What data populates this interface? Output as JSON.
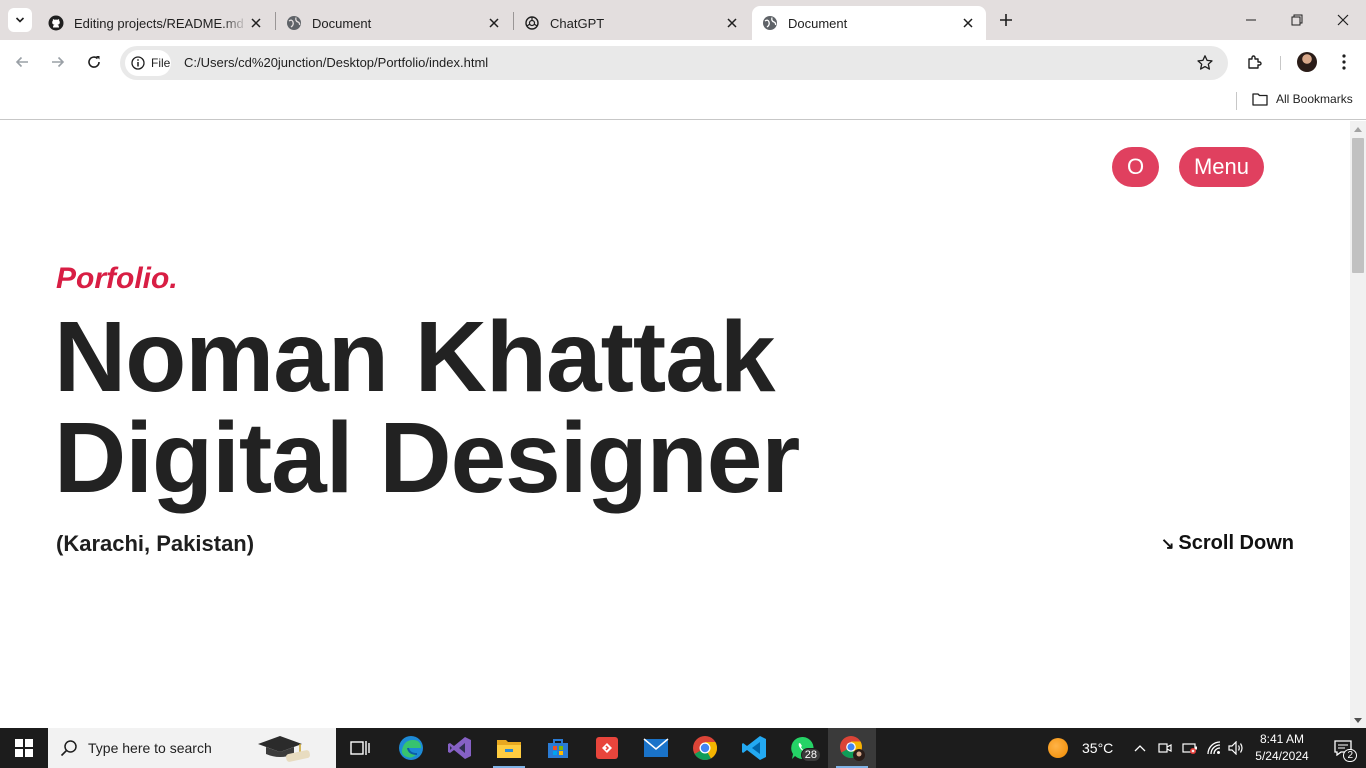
{
  "browser": {
    "tabs": [
      {
        "title": "Editing projects/README.md at",
        "icon": "github-icon",
        "active": false
      },
      {
        "title": "Document",
        "icon": "globe-icon",
        "active": false
      },
      {
        "title": "ChatGPT",
        "icon": "chatgpt-icon",
        "active": false
      },
      {
        "title": "Document",
        "icon": "globe-icon",
        "active": true
      }
    ],
    "omnibox": {
      "chip_label": "File",
      "url": "C:/Users/cd%20junction/Desktop/Portfolio/index.html"
    },
    "bookmarks": {
      "all_label": "All Bookmarks"
    }
  },
  "page": {
    "buttons": {
      "circle_label": "O",
      "menu_label": "Menu"
    },
    "kicker": "Porfolio.",
    "headline_line1": "Noman Khattak",
    "headline_line2": "Digital Designer",
    "location": "(Karachi, Pakistan)",
    "scroll_arrow": "↘",
    "scroll_label": "Scroll Down",
    "accent_color": "#e0405f",
    "kicker_color": "#d81e44"
  },
  "taskbar": {
    "search_placeholder": "Type here to search",
    "apps": [
      "task-view-icon",
      "edge-icon",
      "visual-studio-icon",
      "file-explorer-icon",
      "microsoft-store-icon",
      "git-icon",
      "mail-icon",
      "chrome-icon",
      "vscode-icon",
      "whatsapp-icon",
      "chrome-profile-icon"
    ],
    "whatsapp_badge": "28",
    "weather_temp": "35°C",
    "time": "8:41 AM",
    "date": "5/24/2024",
    "notification_count": "2"
  }
}
